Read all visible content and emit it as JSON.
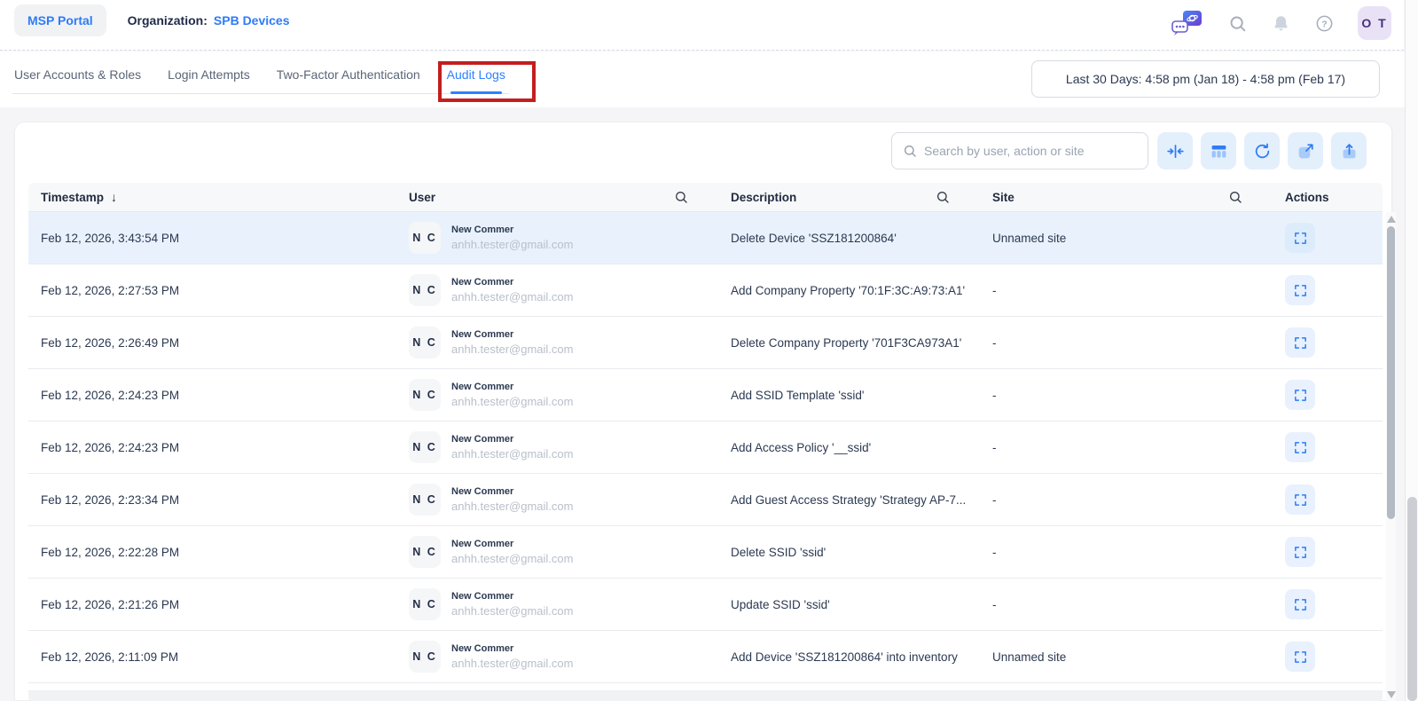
{
  "topbar": {
    "portal_button": "MSP Portal",
    "organization_label": "Organization:",
    "organization_name": "SPB Devices",
    "avatar_initials": "O T",
    "icons": {
      "ai_assistant": "chat-bubbles-with-sparkle",
      "search": "magnifier",
      "notifications": "bell",
      "help": "question-circle"
    }
  },
  "tabs": {
    "items": [
      {
        "label": "User Accounts & Roles",
        "active": false
      },
      {
        "label": "Login Attempts",
        "active": false
      },
      {
        "label": "Two-Factor Authentication",
        "active": false
      },
      {
        "label": "Audit Logs",
        "active": true
      }
    ],
    "annotation": {
      "shape": "red-box",
      "around": "Audit Logs",
      "color": "#c41e1e"
    },
    "date_range": "Last 30 Days: 4:58 pm (Jan 18) - 4:58 pm (Feb 17)"
  },
  "controls": {
    "search_placeholder": "Search by user, action or site",
    "buttons": [
      {
        "name": "collapse-columns"
      },
      {
        "name": "columns"
      },
      {
        "name": "refresh"
      },
      {
        "name": "expand"
      },
      {
        "name": "export"
      }
    ]
  },
  "table": {
    "headers": {
      "timestamp": "Timestamp",
      "sort_arrow": "↓",
      "user": "User",
      "description": "Description",
      "site": "Site",
      "actions": "Actions"
    },
    "row_action_icon": "expand-fullscreen-brackets",
    "rows": [
      {
        "timestamp": "Feb 12, 2026, 3:43:54 PM",
        "user": {
          "initials": "N C",
          "name": "New Commer",
          "email": "anhh.tester@gmail.com"
        },
        "description": "Delete Device 'SSZ181200864'",
        "site": "Unnamed site",
        "highlighted": true
      },
      {
        "timestamp": "Feb 12, 2026, 2:27:53 PM",
        "user": {
          "initials": "N C",
          "name": "New Commer",
          "email": "anhh.tester@gmail.com"
        },
        "description": "Add Company Property '70:1F:3C:A9:73:A1'",
        "site": "-",
        "highlighted": false
      },
      {
        "timestamp": "Feb 12, 2026, 2:26:49 PM",
        "user": {
          "initials": "N C",
          "name": "New Commer",
          "email": "anhh.tester@gmail.com"
        },
        "description": "Delete Company Property '701F3CA973A1'",
        "site": "-",
        "highlighted": false
      },
      {
        "timestamp": "Feb 12, 2026, 2:24:23 PM",
        "user": {
          "initials": "N C",
          "name": "New Commer",
          "email": "anhh.tester@gmail.com"
        },
        "description": "Add SSID Template 'ssid'",
        "site": "-",
        "highlighted": false
      },
      {
        "timestamp": "Feb 12, 2026, 2:24:23 PM",
        "user": {
          "initials": "N C",
          "name": "New Commer",
          "email": "anhh.tester@gmail.com"
        },
        "description": "Add Access Policy '__ssid'",
        "site": "-",
        "highlighted": false
      },
      {
        "timestamp": "Feb 12, 2026, 2:23:34 PM",
        "user": {
          "initials": "N C",
          "name": "New Commer",
          "email": "anhh.tester@gmail.com"
        },
        "description": "Add Guest Access Strategy 'Strategy AP-7...",
        "site": "-",
        "highlighted": false
      },
      {
        "timestamp": "Feb 12, 2026, 2:22:28 PM",
        "user": {
          "initials": "N C",
          "name": "New Commer",
          "email": "anhh.tester@gmail.com"
        },
        "description": "Delete SSID 'ssid'",
        "site": "-",
        "highlighted": false
      },
      {
        "timestamp": "Feb 12, 2026, 2:21:26 PM",
        "user": {
          "initials": "N C",
          "name": "New Commer",
          "email": "anhh.tester@gmail.com"
        },
        "description": "Update SSID 'ssid'",
        "site": "-",
        "highlighted": false
      },
      {
        "timestamp": "Feb 12, 2026, 2:11:09 PM",
        "user": {
          "initials": "N C",
          "name": "New Commer",
          "email": "anhh.tester@gmail.com"
        },
        "description": "Add Device 'SSZ181200864' into inventory",
        "site": "Unnamed site",
        "highlighted": false
      }
    ]
  },
  "colors": {
    "accent_blue": "#2e7cf6",
    "highlight_row": "#e9f2fc",
    "annotation_red": "#c41e1e",
    "tool_button_bg": "#e4effc"
  }
}
